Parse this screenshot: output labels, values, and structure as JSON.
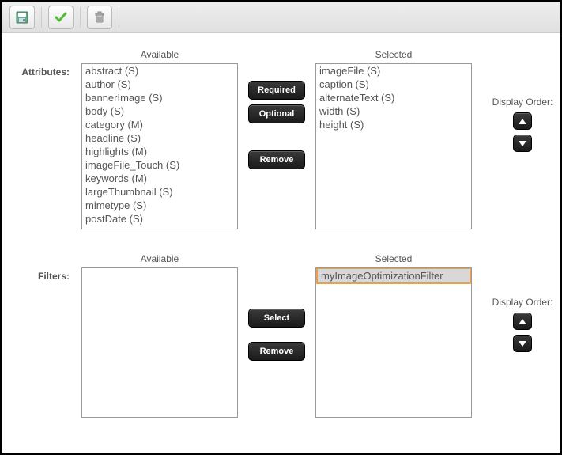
{
  "toolbar": {
    "save": "save",
    "confirm": "confirm",
    "delete": "delete"
  },
  "attributes": {
    "label": "Attributes:",
    "available_header": "Available",
    "selected_header": "Selected",
    "available": [
      "abstract (S)",
      "author (S)",
      "bannerImage (S)",
      "body (S)",
      "category (M)",
      "headline (S)",
      "highlights (M)",
      "imageFile_Touch (S)",
      "keywords (M)",
      "largeThumbnail (S)",
      "mimetype (S)",
      "postDate (S)"
    ],
    "selected": [
      "imageFile (S)",
      "caption (S)",
      "alternateText (S)",
      "width (S)",
      "height (S)"
    ],
    "btn_required": "Required",
    "btn_optional": "Optional",
    "btn_remove": "Remove",
    "order_label": "Display Order:"
  },
  "filters": {
    "label": "Filters:",
    "available_header": "Available",
    "selected_header": "Selected",
    "available": [],
    "selected": [
      "myImageOptimizationFilter"
    ],
    "btn_select": "Select",
    "btn_remove": "Remove",
    "order_label": "Display Order:"
  }
}
